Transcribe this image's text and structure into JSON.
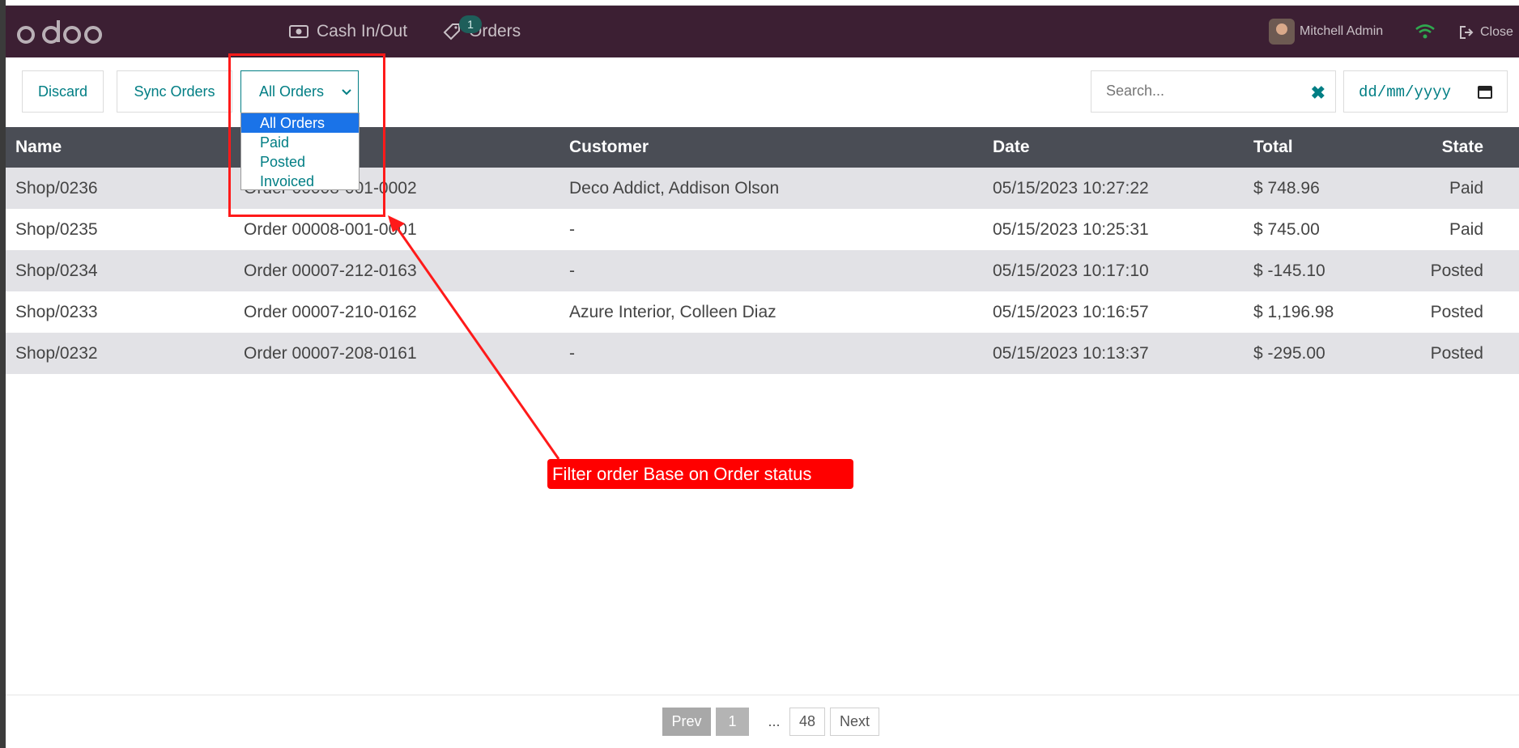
{
  "navbar": {
    "logo_text": "odoo",
    "cash_label": "Cash In/Out",
    "orders_label": "Orders",
    "orders_badge": "1",
    "user_name": "Mitchell Admin",
    "close_label": "Close",
    "bg_color": "#3c1f33"
  },
  "controls": {
    "discard_label": "Discard",
    "sync_label": "Sync Orders",
    "filter_selected": "All Orders",
    "filter_options": [
      "All Orders",
      "Paid",
      "Posted",
      "Invoiced"
    ],
    "search_placeholder": "Search...",
    "date_placeholder": "dd/mm/yyyy",
    "accent_color": "#017e84"
  },
  "table": {
    "headers": [
      "Name",
      "",
      "Customer",
      "Date",
      "Total",
      "State"
    ],
    "rows": [
      {
        "name": "Shop/0236",
        "ref": "Order 00008-001-0002",
        "customer": "Deco Addict, Addison Olson",
        "date": "05/15/2023 10:27:22",
        "total": "$ 748.96",
        "state": "Paid"
      },
      {
        "name": "Shop/0235",
        "ref": "Order 00008-001-0001",
        "customer": "-",
        "date": "05/15/2023 10:25:31",
        "total": "$ 745.00",
        "state": "Paid"
      },
      {
        "name": "Shop/0234",
        "ref": "Order 00007-212-0163",
        "customer": "-",
        "date": "05/15/2023 10:17:10",
        "total": "$ -145.10",
        "state": "Posted"
      },
      {
        "name": "Shop/0233",
        "ref": "Order 00007-210-0162",
        "customer": "Azure Interior, Colleen Diaz",
        "date": "05/15/2023 10:16:57",
        "total": "$ 1,196.98",
        "state": "Posted"
      },
      {
        "name": "Shop/0232",
        "ref": "Order 00007-208-0161",
        "customer": "-",
        "date": "05/15/2023 10:13:37",
        "total": "$ -295.00",
        "state": "Posted"
      }
    ]
  },
  "annotation": {
    "text": "Filter  order Base on Order status",
    "color": "#ff0000"
  },
  "pagination": {
    "prev_label": "Prev",
    "current_page": "1",
    "ellipsis": "...",
    "last_page": "48",
    "next_label": "Next"
  }
}
